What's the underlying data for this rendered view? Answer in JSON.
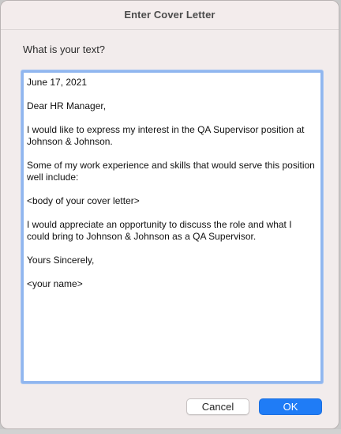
{
  "dialog": {
    "title": "Enter Cover Letter",
    "prompt": "What is your text?",
    "text_value": "June 17, 2021\n\nDear HR Manager,\n\nI would like to express my interest in the QA Supervisor position at Johnson & Johnson.\n\nSome of my work experience and skills that would serve this position well include:\n\n<body of your cover letter>\n\nI would appreciate an opportunity to discuss the role and what I could bring to Johnson & Johnson as a QA Supervisor.\n\nYours Sincerely,\n\n<your name>",
    "buttons": {
      "cancel_label": "Cancel",
      "ok_label": "OK"
    }
  },
  "colors": {
    "window_bg": "#f2ecec",
    "focus_ring": "#90b6ef",
    "ok_button": "#1f7cf6"
  }
}
